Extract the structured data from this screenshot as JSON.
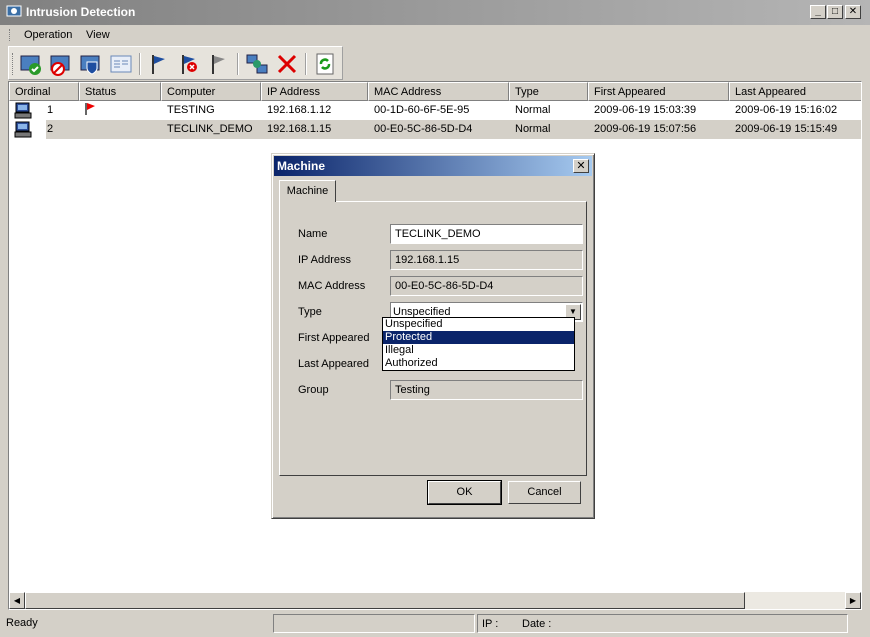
{
  "window": {
    "title": "Intrusion Detection"
  },
  "menu": {
    "operation": "Operation",
    "view": "View"
  },
  "toolbar": {
    "buttons": [
      "accept-icon",
      "block-icon",
      "shield-icon",
      "properties-icon",
      "flag-blue-icon",
      "flag-remove-icon",
      "flag-gray-icon",
      "network-icon",
      "delete-icon",
      "refresh-icon"
    ]
  },
  "list": {
    "columns": [
      "Ordinal",
      "Status",
      "Computer",
      "IP Address",
      "MAC Address",
      "Type",
      "First Appeared",
      "Last Appeared"
    ],
    "rows": [
      {
        "ordinal": "1",
        "computer": "TESTING",
        "ip": "192.168.1.12",
        "mac": "00-1D-60-6F-5E-95",
        "type": "Normal",
        "first": "2009-06-19 15:03:39",
        "last": "2009-06-19 15:16:02"
      },
      {
        "ordinal": "2",
        "computer": "TECLINK_DEMO",
        "ip": "192.168.1.15",
        "mac": "00-E0-5C-86-5D-D4",
        "type": "Normal",
        "first": "2009-06-19 15:07:56",
        "last": "2009-06-19 15:15:49"
      }
    ]
  },
  "status": {
    "ready": "Ready",
    "ip": "IP :",
    "date": "Date :"
  },
  "dialog": {
    "title": "Machine",
    "tab": "Machine",
    "labels": {
      "name": "Name",
      "ip": "IP Address",
      "mac": "MAC Address",
      "type": "Type",
      "first": "First Appeared",
      "last": "Last Appeared",
      "group": "Group"
    },
    "values": {
      "name": "TECLINK_DEMO",
      "ip": "192.168.1.15",
      "mac": "00-E0-5C-86-5D-D4",
      "type": "Unspecified",
      "group": "Testing"
    },
    "type_options": [
      "Unspecified",
      "Protected",
      "Illegal",
      "Authorized"
    ],
    "ok": "OK",
    "cancel": "Cancel"
  }
}
